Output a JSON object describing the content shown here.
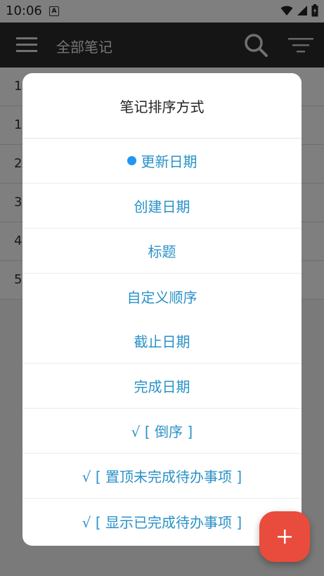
{
  "status_bar": {
    "time": "10:06",
    "a_label": "A"
  },
  "app_bar": {
    "title": "全部笔记"
  },
  "list": {
    "rows": [
      "1",
      "1",
      "2",
      "3",
      "4",
      "5"
    ]
  },
  "dialog": {
    "title": "笔记排序方式",
    "options": [
      {
        "label": "更新日期",
        "selected": true
      },
      {
        "label": "创建日期",
        "selected": false
      },
      {
        "label": "标题",
        "selected": false
      },
      {
        "label": "自定义顺序",
        "selected": false
      },
      {
        "label": "截止日期",
        "selected": false
      },
      {
        "label": "完成日期",
        "selected": false
      },
      {
        "label": "√ [ 倒序 ]",
        "selected": false
      },
      {
        "label": "√ [ 置顶未完成待办事项 ]",
        "selected": false
      },
      {
        "label": "√ [ 显示已完成待办事项 ]",
        "selected": false
      }
    ]
  },
  "colors": {
    "app_bar": "#2b2b2b",
    "option_text": "#2a92c8",
    "selected_dot": "#2196f3",
    "fab": "#e94b3c"
  },
  "icons": {
    "menu": "hamburger-menu-icon",
    "search": "search-icon",
    "filter": "filter-sort-icon",
    "fab": "plus-icon"
  }
}
